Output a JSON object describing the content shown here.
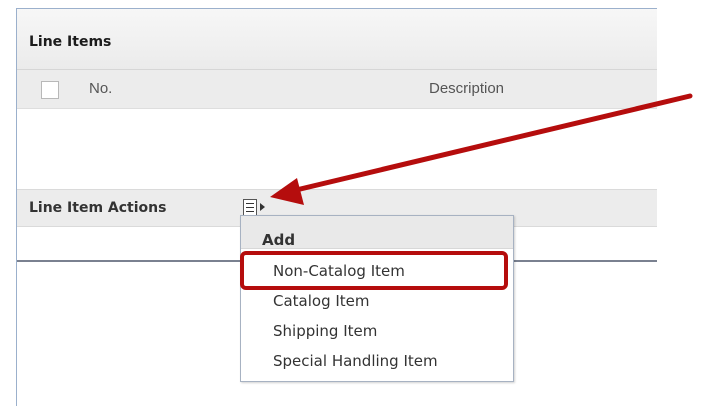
{
  "line_items": {
    "title": "Line Items",
    "columns": {
      "number": "No.",
      "description": "Description"
    }
  },
  "actions": {
    "label": "Line Item Actions",
    "menu_icon": "list-menu-icon"
  },
  "dropdown": {
    "heading": "Add",
    "items": [
      "Non-Catalog Item",
      "Catalog Item",
      "Shipping Item",
      "Special Handling Item"
    ]
  },
  "annotation": {
    "arrow_color": "#b50d0d",
    "highlight_color": "#b50d0d",
    "highlighted_item": "Non-Catalog Item"
  }
}
